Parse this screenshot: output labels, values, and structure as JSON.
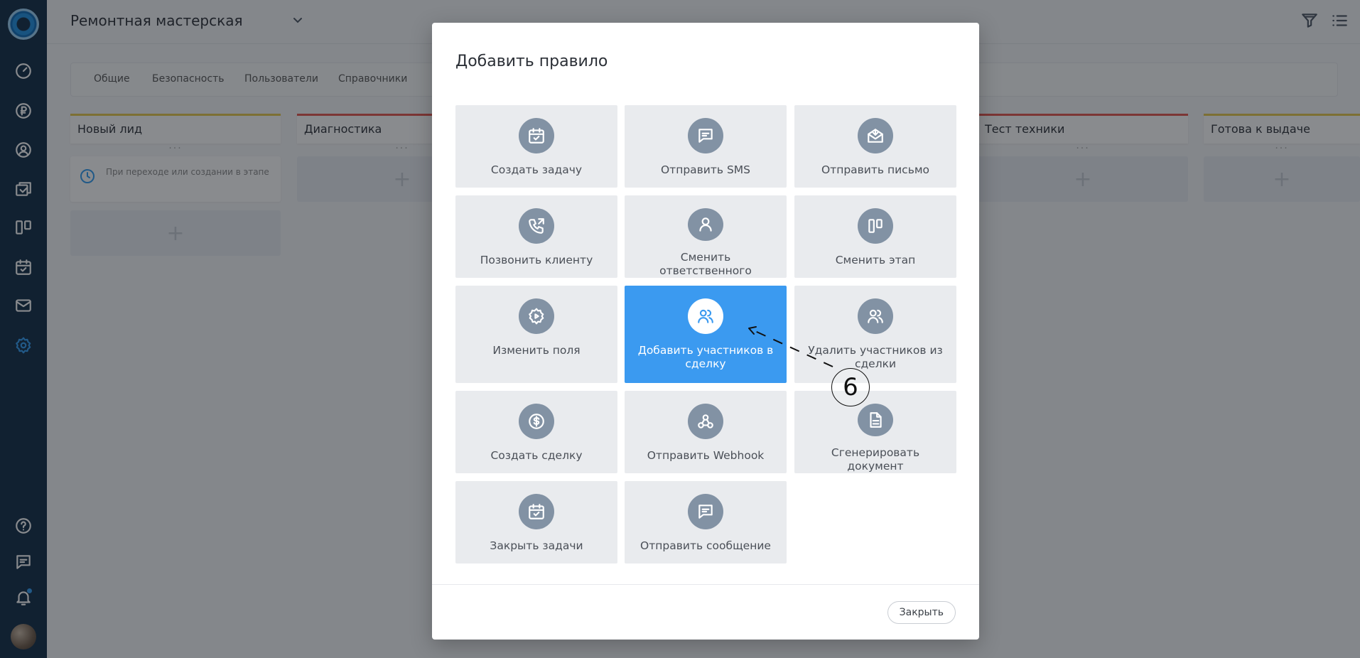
{
  "header": {
    "title": "Ремонтная мастерская"
  },
  "tabs": [
    "Общие",
    "Безопасность",
    "Пользователи",
    "Справочники"
  ],
  "columns": [
    {
      "title": "Новый лид",
      "rule_text": "При переходе или создании в этапе"
    },
    {
      "title": "Диагностика"
    },
    {
      "title": "Тест техники"
    },
    {
      "title": "Готова к выдаче"
    }
  ],
  "modal": {
    "title": "Добавить правило",
    "close_label": "Закрыть",
    "actions": [
      {
        "label": "Создать задачу",
        "icon": "calendar-check-icon"
      },
      {
        "label": "Отправить SMS",
        "icon": "message-icon"
      },
      {
        "label": "Отправить письмо",
        "icon": "mail-open-icon"
      },
      {
        "label": "Позвонить клиенту",
        "icon": "phone-outgoing-icon"
      },
      {
        "label": "Сменить ответственного",
        "icon": "user-icon"
      },
      {
        "label": "Сменить этап",
        "icon": "columns-icon"
      },
      {
        "label": "Изменить поля",
        "icon": "gear-icon"
      },
      {
        "label": "Добавить участников в сделку",
        "icon": "users-icon",
        "selected": true
      },
      {
        "label": "Удалить участников из сделки",
        "icon": "users-icon"
      },
      {
        "label": "Создать сделку",
        "icon": "dollar-circle-icon"
      },
      {
        "label": "Отправить Webhook",
        "icon": "webhook-icon"
      },
      {
        "label": "Сгенерировать документ",
        "icon": "document-icon"
      },
      {
        "label": "Закрыть задачи",
        "icon": "calendar-check-icon"
      },
      {
        "label": "Отправить сообщение",
        "icon": "message-icon"
      }
    ]
  },
  "annotation": {
    "label": "6"
  },
  "colors": {
    "sidebar": "#0f2a45",
    "accent": "#3b9af0",
    "card": "#e9ebee",
    "card_icon": "#8292a4"
  }
}
